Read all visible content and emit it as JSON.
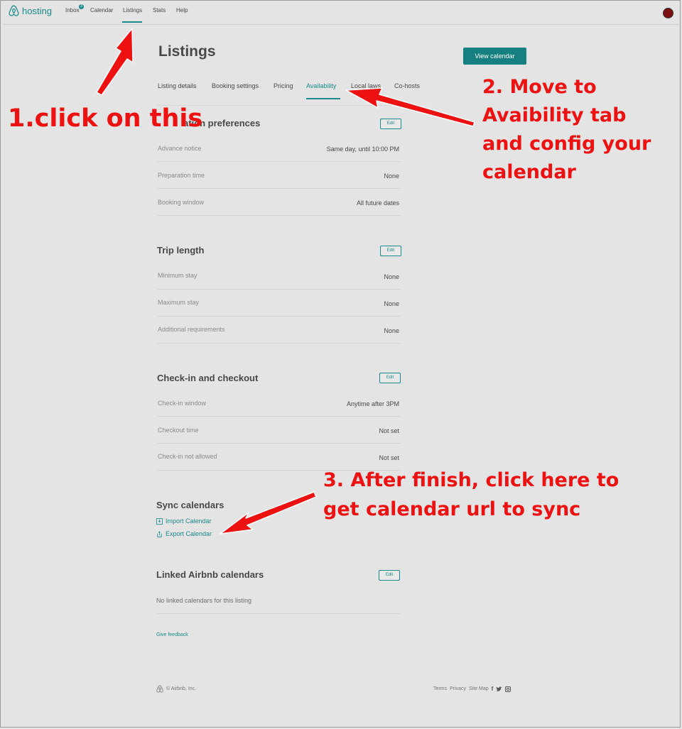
{
  "nav": {
    "brand": "hosting",
    "items": [
      "Inbox",
      "Calendar",
      "Listings",
      "Stats",
      "Help"
    ],
    "inbox_badge": "3",
    "active": "Listings"
  },
  "page": {
    "title": "Listings",
    "view_calendar": "View calendar",
    "tabs": [
      "Listing details",
      "Booking settings",
      "Pricing",
      "Availability",
      "Local laws",
      "Co-hosts"
    ],
    "active_tab": "Availability"
  },
  "reservation": {
    "title_visible": "ation preferences",
    "edit": "Edit",
    "rows": [
      {
        "label": "Advance notice",
        "value": "Same day, until 10:00 PM"
      },
      {
        "label": "Preparation time",
        "value": "None"
      },
      {
        "label": "Booking window",
        "value": "All future dates"
      }
    ]
  },
  "trip": {
    "title": "Trip length",
    "edit": "Edit",
    "rows": [
      {
        "label": "Minimum stay",
        "value": "None"
      },
      {
        "label": "Maximum stay",
        "value": "None"
      },
      {
        "label": "Additional requirements",
        "value": "None"
      }
    ]
  },
  "checkin": {
    "title": "Check-in and checkout",
    "edit": "Edit",
    "rows": [
      {
        "label": "Check-in window",
        "value": "Anytime after 3PM"
      },
      {
        "label": "Checkout time",
        "value": "Not set"
      },
      {
        "label": "Check-in not allowed",
        "value": "Not set"
      }
    ]
  },
  "sync": {
    "title": "Sync calendars",
    "import": "Import Calendar",
    "export": "Export Calendar"
  },
  "linked": {
    "title": "Linked Airbnb calendars",
    "edit": "Edit",
    "empty": "No linked calendars for this listing"
  },
  "feedback": "Give feedback",
  "footer": {
    "copyright": "© Airbnb, Inc.",
    "links": [
      "Terms",
      "Privacy",
      "Site Map"
    ],
    "social_icons": [
      "facebook-icon",
      "twitter-icon",
      "instagram-icon"
    ]
  },
  "annotations": {
    "step1": "1.click on this",
    "step2": [
      "2. Move to",
      "Avaibility tab",
      "and config your",
      "calendar"
    ],
    "step3": [
      "3. After finish, click here to",
      "get calendar url to sync"
    ]
  },
  "colors": {
    "accent": "#1a8a8a",
    "button": "#167f7f",
    "annotation": "#ee1111"
  }
}
